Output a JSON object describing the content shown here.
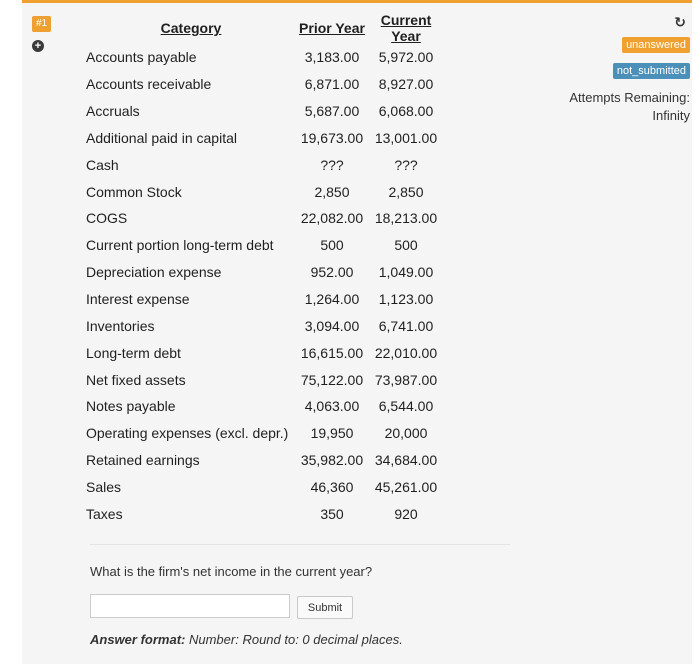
{
  "question_number": "#1",
  "columns": {
    "category": "Category",
    "prior": "Prior Year",
    "current": "Current Year"
  },
  "rows": [
    {
      "category": "Accounts payable",
      "prior": "3,183.00",
      "current": "5,972.00"
    },
    {
      "category": "Accounts receivable",
      "prior": "6,871.00",
      "current": "8,927.00"
    },
    {
      "category": "Accruals",
      "prior": "5,687.00",
      "current": "6,068.00"
    },
    {
      "category": "Additional paid in capital",
      "prior": "19,673.00",
      "current": "13,001.00"
    },
    {
      "category": "Cash",
      "prior": "???",
      "current": "???"
    },
    {
      "category": "Common Stock",
      "prior": "2,850",
      "current": "2,850"
    },
    {
      "category": "COGS",
      "prior": "22,082.00",
      "current": "18,213.00"
    },
    {
      "category": "Current portion long-term debt",
      "prior": "500",
      "current": "500"
    },
    {
      "category": "Depreciation expense",
      "prior": "952.00",
      "current": "1,049.00"
    },
    {
      "category": "Interest expense",
      "prior": "1,264.00",
      "current": "1,123.00"
    },
    {
      "category": "Inventories",
      "prior": "3,094.00",
      "current": "6,741.00"
    },
    {
      "category": "Long-term debt",
      "prior": "16,615.00",
      "current": "22,010.00"
    },
    {
      "category": "Net fixed assets",
      "prior": "75,122.00",
      "current": "73,987.00"
    },
    {
      "category": "Notes payable",
      "prior": "4,063.00",
      "current": "6,544.00"
    },
    {
      "category": "Operating expenses (excl. depr.)",
      "prior": "19,950",
      "current": "20,000"
    },
    {
      "category": "Retained earnings",
      "prior": "35,982.00",
      "current": "34,684.00"
    },
    {
      "category": "Sales",
      "prior": "46,360",
      "current": "45,261.00"
    },
    {
      "category": "Taxes",
      "prior": "350",
      "current": "920"
    }
  ],
  "status": {
    "unanswered": "unanswered",
    "not_submitted": "not_submitted",
    "attempts_label": "Attempts Remaining:",
    "attempts_value": "Infinity"
  },
  "question_text": "What is the firm's net income in the current year?",
  "answer": {
    "value": "",
    "placeholder": ""
  },
  "submit_label": "Submit",
  "answer_format": {
    "label": "Answer format:",
    "text": "Number: Round to: 0 decimal places."
  },
  "icons": {
    "refresh": "refresh-icon",
    "expand": "plus-circle-icon"
  },
  "colors": {
    "accent_orange": "#f0a030",
    "status_blue": "#4a90b8"
  }
}
